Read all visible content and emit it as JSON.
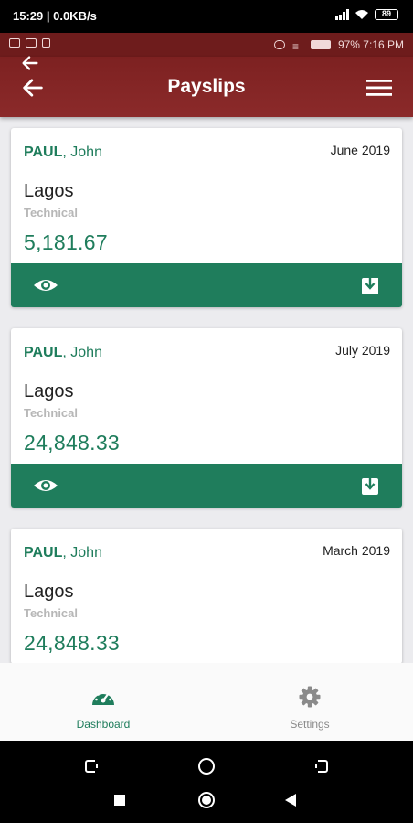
{
  "device_status": {
    "time_speed": "15:29 | 0.0KB/s",
    "battery": "89"
  },
  "inner_status": {
    "right_text": "97% 7:16 PM"
  },
  "header": {
    "title": "Payslips"
  },
  "payslips": [
    {
      "surname": "PAUL",
      "given": ", John",
      "month": "June 2019",
      "city": "Lagos",
      "dept": "Technical",
      "amount": "5,181.67"
    },
    {
      "surname": "PAUL",
      "given": ", John",
      "month": "July 2019",
      "city": "Lagos",
      "dept": "Technical",
      "amount": "24,848.33"
    },
    {
      "surname": "PAUL",
      "given": ", John",
      "month": "March 2019",
      "city": "Lagos",
      "dept": "Technical",
      "amount": "24,848.33"
    }
  ],
  "card_actions": {
    "view_icon": "eye-icon",
    "download_icon": "download-icon"
  },
  "bottom_nav": {
    "items": [
      {
        "label": "Dashboard",
        "icon": "speedometer-icon",
        "active": true
      },
      {
        "label": "Settings",
        "icon": "gear-icon",
        "active": false
      }
    ]
  },
  "colors": {
    "header": "#7d2121",
    "accent": "#1f7d5c",
    "background": "#ececef"
  }
}
